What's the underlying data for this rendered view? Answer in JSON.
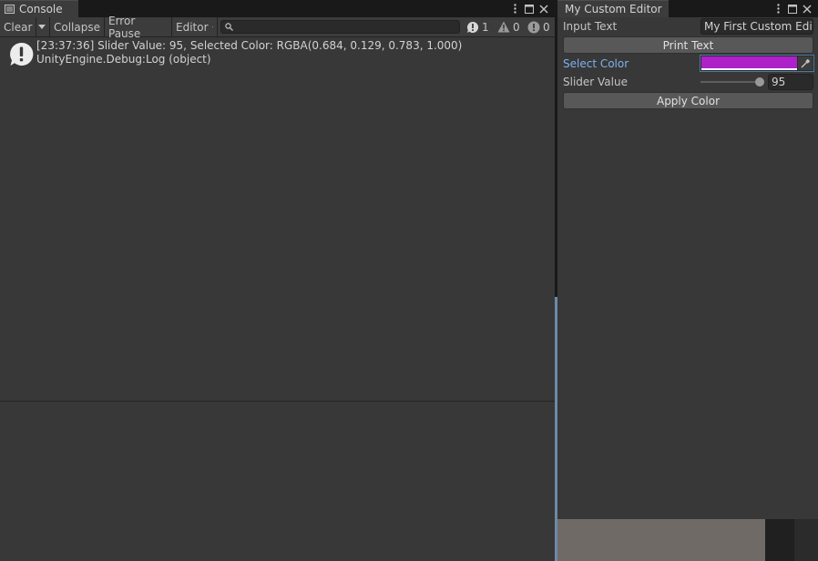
{
  "console": {
    "tab_title": "Console",
    "toolbar": {
      "clear_label": "Clear",
      "collapse_label": "Collapse",
      "error_pause_label": "Error Pause",
      "editor_label": "Editor",
      "log_count": "1",
      "warning_count": "0",
      "error_count": "0"
    },
    "entries": [
      {
        "line1": "[23:37:36] Slider Value: 95, Selected Color: RGBA(0.684, 0.129, 0.783, 1.000)",
        "line2": "UnityEngine.Debug:Log (object)"
      }
    ]
  },
  "custom_editor": {
    "tab_title": "My Custom Editor",
    "input_text_label": "Input Text",
    "input_text_value": "My First Custom Editor",
    "print_button_label": "Print Text",
    "select_color_label": "Select Color",
    "selected_color": "#ae21c8",
    "slider_label": "Slider Value",
    "slider_value": "95",
    "slider_fraction": 0.95,
    "apply_button_label": "Apply Color"
  },
  "colors": {
    "panel_bg": "#383838",
    "tab_strip_bg": "#191919",
    "focused_label": "#7fb2ee"
  },
  "icons": [
    "console-icon",
    "more-icon",
    "maximize-icon",
    "close-icon",
    "dropdown-arrow-icon",
    "search-icon",
    "info-icon",
    "warning-icon",
    "error-icon",
    "eyedropper-icon"
  ]
}
